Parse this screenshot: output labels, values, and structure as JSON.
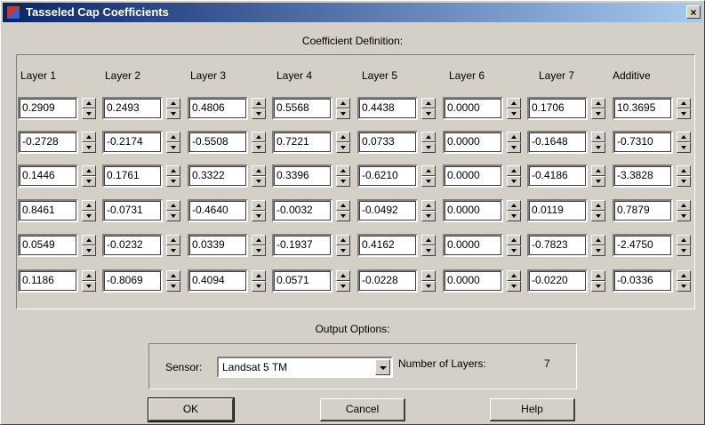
{
  "window": {
    "title": "Tasseled Cap Coefficients",
    "close_glyph": "×"
  },
  "coefficient_section": {
    "label": "Coefficient Definition:",
    "columns": [
      "Layer 1",
      "Layer 2",
      "Layer 3",
      "Layer 4",
      "Layer 5",
      "Layer 6",
      "Layer 7",
      "Additive"
    ],
    "rows": [
      [
        "0.2909",
        "0.2493",
        "0.4806",
        "0.5568",
        "0.4438",
        "0.0000",
        "0.1706",
        "10.3695"
      ],
      [
        "-0.2728",
        "-0.2174",
        "-0.5508",
        "0.7221",
        "0.0733",
        "0.0000",
        "-0.1648",
        "-0.7310"
      ],
      [
        "0.1446",
        "0.1761",
        "0.3322",
        "0.3396",
        "-0.6210",
        "0.0000",
        "-0.4186",
        "-3.3828"
      ],
      [
        "0.8461",
        "-0.0731",
        "-0.4640",
        "-0.0032",
        "-0.0492",
        "0.0000",
        "0.0119",
        "0.7879"
      ],
      [
        "0.0549",
        "-0.0232",
        "0.0339",
        "-0.1937",
        "0.4162",
        "0.0000",
        "-0.7823",
        "-2.4750"
      ],
      [
        "0.1186",
        "-0.8069",
        "0.4094",
        "0.0571",
        "-0.0228",
        "0.0000",
        "-0.0220",
        "-0.0336"
      ]
    ]
  },
  "output_section": {
    "label": "Output Options:",
    "sensor_label": "Sensor:",
    "sensor_value": "Landsat 5 TM",
    "layers_label": "Number of Layers:",
    "layers_value": "7"
  },
  "buttons": {
    "ok": "OK",
    "cancel": "Cancel",
    "help": "Help"
  },
  "icons": {
    "app": "tasseled-cap-icon",
    "close": "close-icon",
    "spin_up": "spin-up-icon",
    "spin_down": "spin-down-icon",
    "dropdown": "dropdown-arrow-icon"
  },
  "colors": {
    "title_start": "#0a246a",
    "title_end": "#a6caf0",
    "face": "#d4d0c8"
  }
}
